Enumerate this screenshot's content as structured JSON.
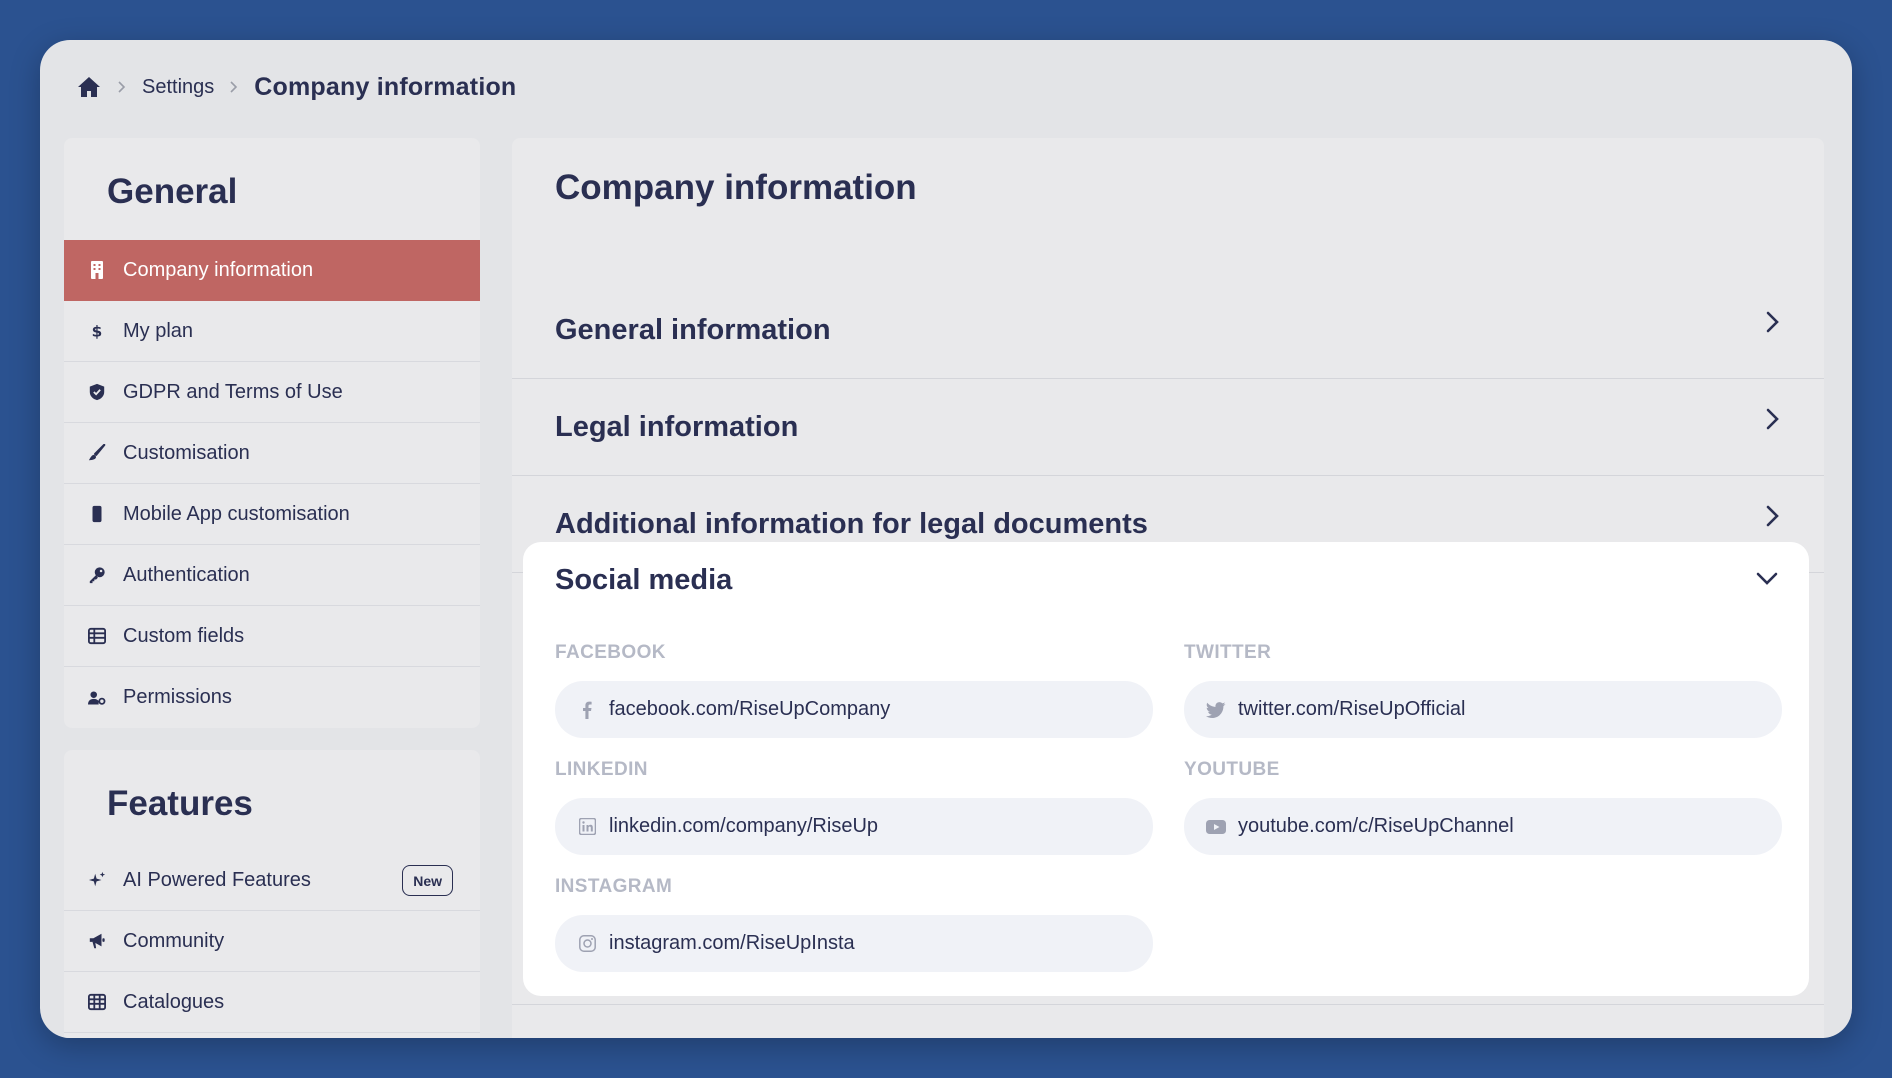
{
  "breadcrumb": {
    "home_icon": "home-icon",
    "items": [
      "Settings",
      "Company information"
    ]
  },
  "sidebar": {
    "general": {
      "title": "General",
      "items": [
        {
          "label": "Company information",
          "icon": "building-icon",
          "active": true
        },
        {
          "label": "My plan",
          "icon": "dollar-icon"
        },
        {
          "label": "GDPR and Terms of Use",
          "icon": "shield-icon"
        },
        {
          "label": "Customisation",
          "icon": "brush-icon"
        },
        {
          "label": "Mobile App customisation",
          "icon": "mobile-icon"
        },
        {
          "label": "Authentication",
          "icon": "key-icon"
        },
        {
          "label": "Custom fields",
          "icon": "table-icon"
        },
        {
          "label": "Permissions",
          "icon": "user-gear-icon"
        }
      ]
    },
    "features": {
      "title": "Features",
      "items": [
        {
          "label": "AI Powered Features",
          "icon": "sparkles-icon",
          "badge": "New"
        },
        {
          "label": "Community",
          "icon": "megaphone-icon"
        },
        {
          "label": "Catalogues",
          "icon": "grid-icon"
        }
      ]
    }
  },
  "main": {
    "title": "Company information",
    "sections": [
      {
        "label": "General information",
        "state": "collapsed"
      },
      {
        "label": "Legal information",
        "state": "collapsed"
      },
      {
        "label": "Additional information for legal documents",
        "state": "collapsed"
      }
    ],
    "social": {
      "title": "Social media",
      "state": "expanded",
      "fields": {
        "facebook": {
          "label": "FACEBOOK",
          "value": "facebook.com/RiseUpCompany",
          "icon": "facebook-icon"
        },
        "twitter": {
          "label": "TWITTER",
          "value": "twitter.com/RiseUpOfficial",
          "icon": "twitter-icon"
        },
        "linkedin": {
          "label": "LINKEDIN",
          "value": "linkedin.com/company/RiseUp",
          "icon": "linkedin-icon"
        },
        "youtube": {
          "label": "YOUTUBE",
          "value": "youtube.com/c/RiseUpChannel",
          "icon": "youtube-icon"
        },
        "instagram": {
          "label": "INSTAGRAM",
          "value": "instagram.com/RiseUpInsta",
          "icon": "instagram-icon"
        }
      }
    }
  },
  "colors": {
    "background": "#2b5290",
    "active_item": "#bf6663",
    "text": "#2a2f52",
    "field_label": "#b5b9c6"
  }
}
